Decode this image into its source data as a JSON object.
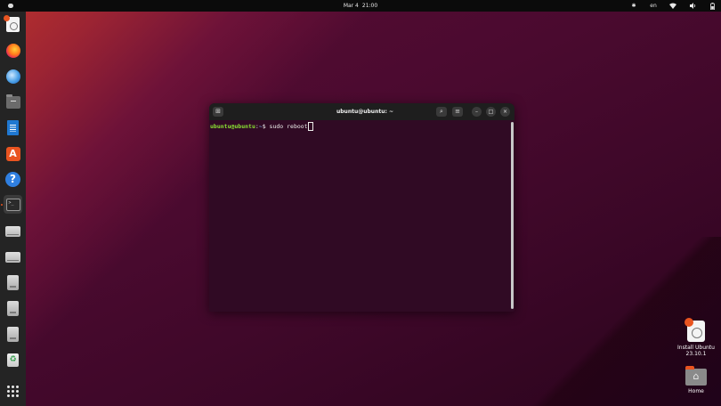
{
  "topbar": {
    "date": "Mar 4",
    "time": "21:00",
    "keyboard_layout": "en",
    "icons": [
      "accessibility-icon",
      "network-wifi-icon",
      "volume-icon",
      "battery-icon"
    ]
  },
  "dock": {
    "items": [
      {
        "name": "install-ubuntu",
        "icon": "installer-icon"
      },
      {
        "name": "firefox",
        "icon": "firefox-icon"
      },
      {
        "name": "thunderbird",
        "icon": "thunderbird-icon"
      },
      {
        "name": "files",
        "icon": "files-folder-icon"
      },
      {
        "name": "libreoffice-writer",
        "icon": "writer-document-icon"
      },
      {
        "name": "app-center",
        "icon": "app-center-icon",
        "glyph": "A"
      },
      {
        "name": "help",
        "icon": "help-icon",
        "glyph": "?"
      },
      {
        "name": "terminal",
        "icon": "terminal-icon",
        "glyph": ">_",
        "active": true
      },
      {
        "name": "drive-1",
        "icon": "drive-icon"
      },
      {
        "name": "drive-2",
        "icon": "drive-icon"
      },
      {
        "name": "disk-1",
        "icon": "disk-icon"
      },
      {
        "name": "disk-2",
        "icon": "disk-icon"
      },
      {
        "name": "disk-3",
        "icon": "disk-icon"
      },
      {
        "name": "trash",
        "icon": "trash-icon",
        "glyph": "♻"
      }
    ],
    "show_apps_icon": "app-grid-icon"
  },
  "terminal": {
    "title": "ubuntu@ubuntu: ~",
    "prompt_user": "ubuntu@ubuntu",
    "prompt_sep": ":",
    "prompt_path": "~",
    "prompt_symbol": "$ ",
    "command": "sudo reboot",
    "buttons": {
      "minimize": "–",
      "maximize": "□",
      "close": "×",
      "search": "⌕",
      "menu": "≡",
      "new_tab": "⊞"
    }
  },
  "desktop_icons": [
    {
      "label_line1": "Install Ubuntu",
      "label_line2": "23.10.1",
      "icon": "installer-icon"
    },
    {
      "label_line1": "Home",
      "icon": "home-folder-icon"
    }
  ],
  "colors": {
    "accent": "#e95420",
    "terminal_bg": "#300a24",
    "prompt_user": "#8ae234",
    "prompt_path": "#729fcf"
  }
}
